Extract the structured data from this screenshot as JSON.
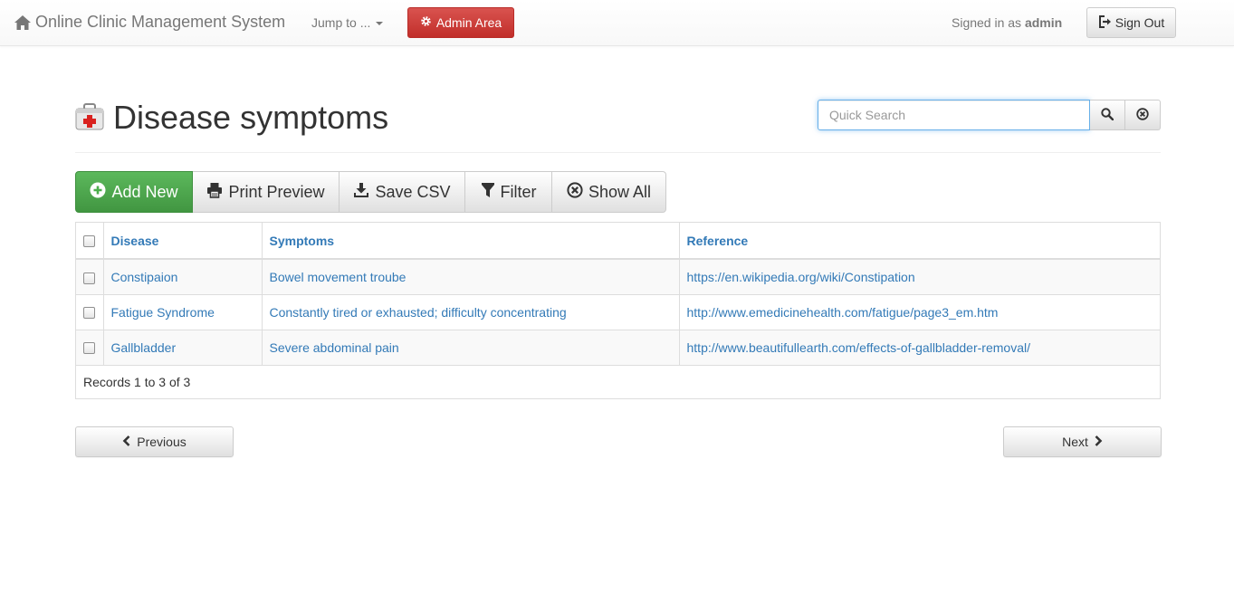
{
  "navbar": {
    "brand": "Online Clinic Management System",
    "jump_label": "Jump to ...",
    "admin_label": "Admin Area",
    "signed_prefix": "Signed in as",
    "signed_user": "admin",
    "signout_label": "Sign Out"
  },
  "page": {
    "title": "Disease symptoms",
    "search_placeholder": "Quick Search"
  },
  "toolbar": {
    "add_new": "Add New",
    "print_preview": "Print Preview",
    "save_csv": "Save CSV",
    "filter": "Filter",
    "show_all": "Show All"
  },
  "table": {
    "columns": [
      "Disease",
      "Symptoms",
      "Reference"
    ],
    "rows": [
      {
        "disease": "Constipaion",
        "symptoms": "Bowel movement troube",
        "reference": "https://en.wikipedia.org/wiki/Constipation"
      },
      {
        "disease": "Fatigue Syndrome",
        "symptoms": "Constantly tired or exhausted; difficulty concentrating",
        "reference": "http://www.emedicinehealth.com/fatigue/page3_em.htm"
      },
      {
        "disease": "Gallbladder",
        "symptoms": "Severe abdominal pain",
        "reference": "http://www.beautifullearth.com/effects-of-gallbladder-removal/"
      }
    ],
    "records_text": "Records 1 to 3 of 3"
  },
  "pager": {
    "previous": "Previous",
    "next": "Next"
  },
  "icons": {
    "brand": "home-icon",
    "admin": "gear-icon",
    "signout": "log-out-icon",
    "title": "first-aid-kit-icon",
    "search": "search-icon",
    "clear": "clear-icon",
    "add": "plus-circle-icon",
    "print": "print-icon",
    "save": "download-icon",
    "filter": "filter-icon",
    "show_all": "remove-circle-icon",
    "previous": "chevron-left-icon",
    "next": "chevron-right-icon"
  },
  "colors": {
    "link": "#337ab7",
    "danger": "#d9534f",
    "success": "#5cb85c"
  }
}
